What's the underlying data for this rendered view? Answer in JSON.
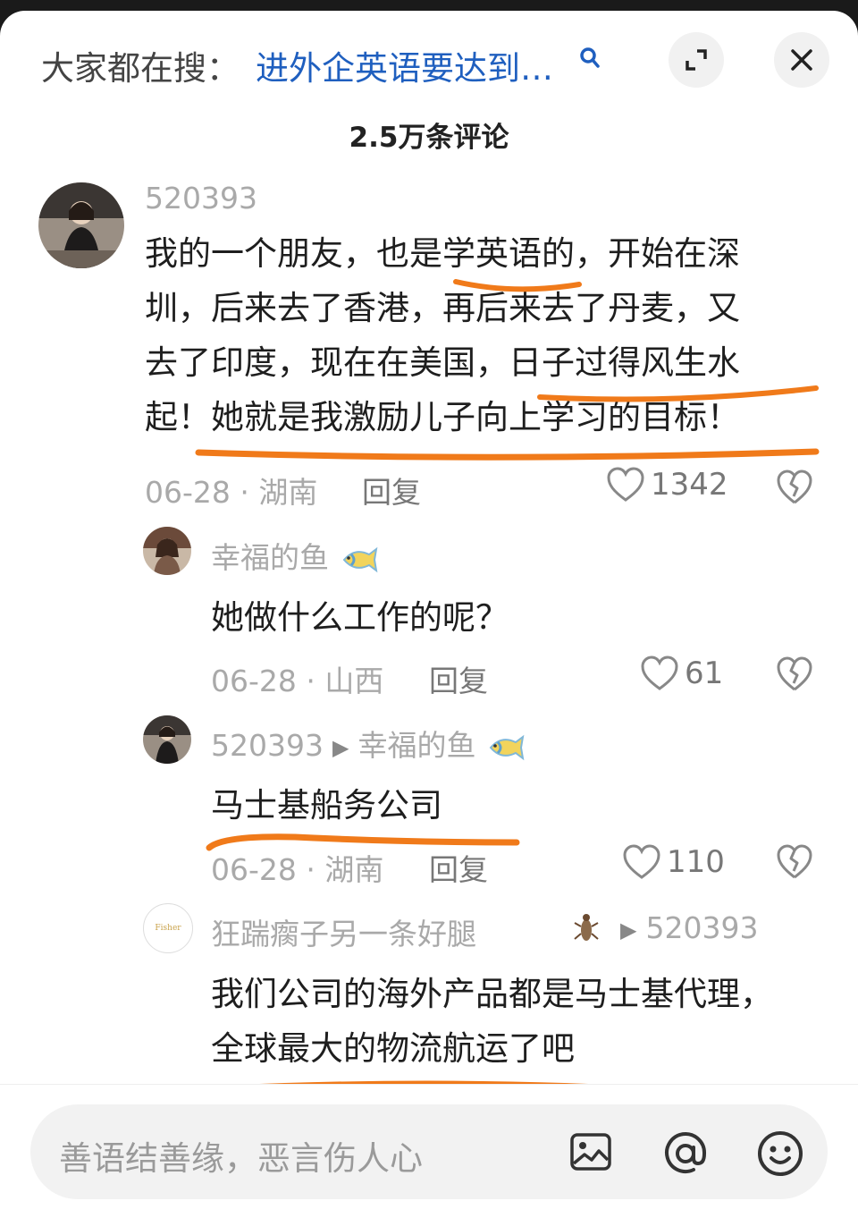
{
  "header": {
    "search_prefix": "大家都在搜：",
    "search_query": "进外企英语要达到…",
    "comment_count": "2.5万条评论"
  },
  "comments": [
    {
      "user": "520393",
      "lines": [
        "我的一个朋友，也是学英语的，开始在深",
        "圳，后来去了香港，再后来去了丹麦，又",
        "去了印度，现在在美国，日子过得风生水",
        "起！她就是我激励儿子向上学习的目标！"
      ],
      "date_loc": "06-28 · 湖南",
      "reply": "回复",
      "likes": "1342"
    },
    {
      "user": "幸福的鱼",
      "lines": [
        "她做什么工作的呢？"
      ],
      "date_loc": "06-28 · 山西",
      "reply": "回复",
      "likes": "61"
    },
    {
      "user": "520393",
      "reply_to": "幸福的鱼",
      "lines": [
        "马士基船务公司"
      ],
      "date_loc": "06-28 · 湖南",
      "reply": "回复",
      "likes": "110"
    },
    {
      "user": "狂踹瘸子另一条好腿",
      "reply_to": "520393",
      "lines": [
        "我们公司的海外产品都是马士基代理，",
        "全球最大的物流航运了吧"
      ],
      "avatar_text": "Fisher"
    }
  ],
  "input": {
    "placeholder": "善语结善缘，恶言伤人心"
  },
  "icons": [
    "search-icon",
    "expand-icon",
    "close-icon",
    "heart-icon",
    "broken-heart-icon",
    "fish-emoji-icon",
    "bug-icon",
    "image-icon",
    "at-icon",
    "smiley-icon"
  ],
  "colors": {
    "link": "#1f5fbf",
    "highlight_marker": "#f07a1a"
  }
}
